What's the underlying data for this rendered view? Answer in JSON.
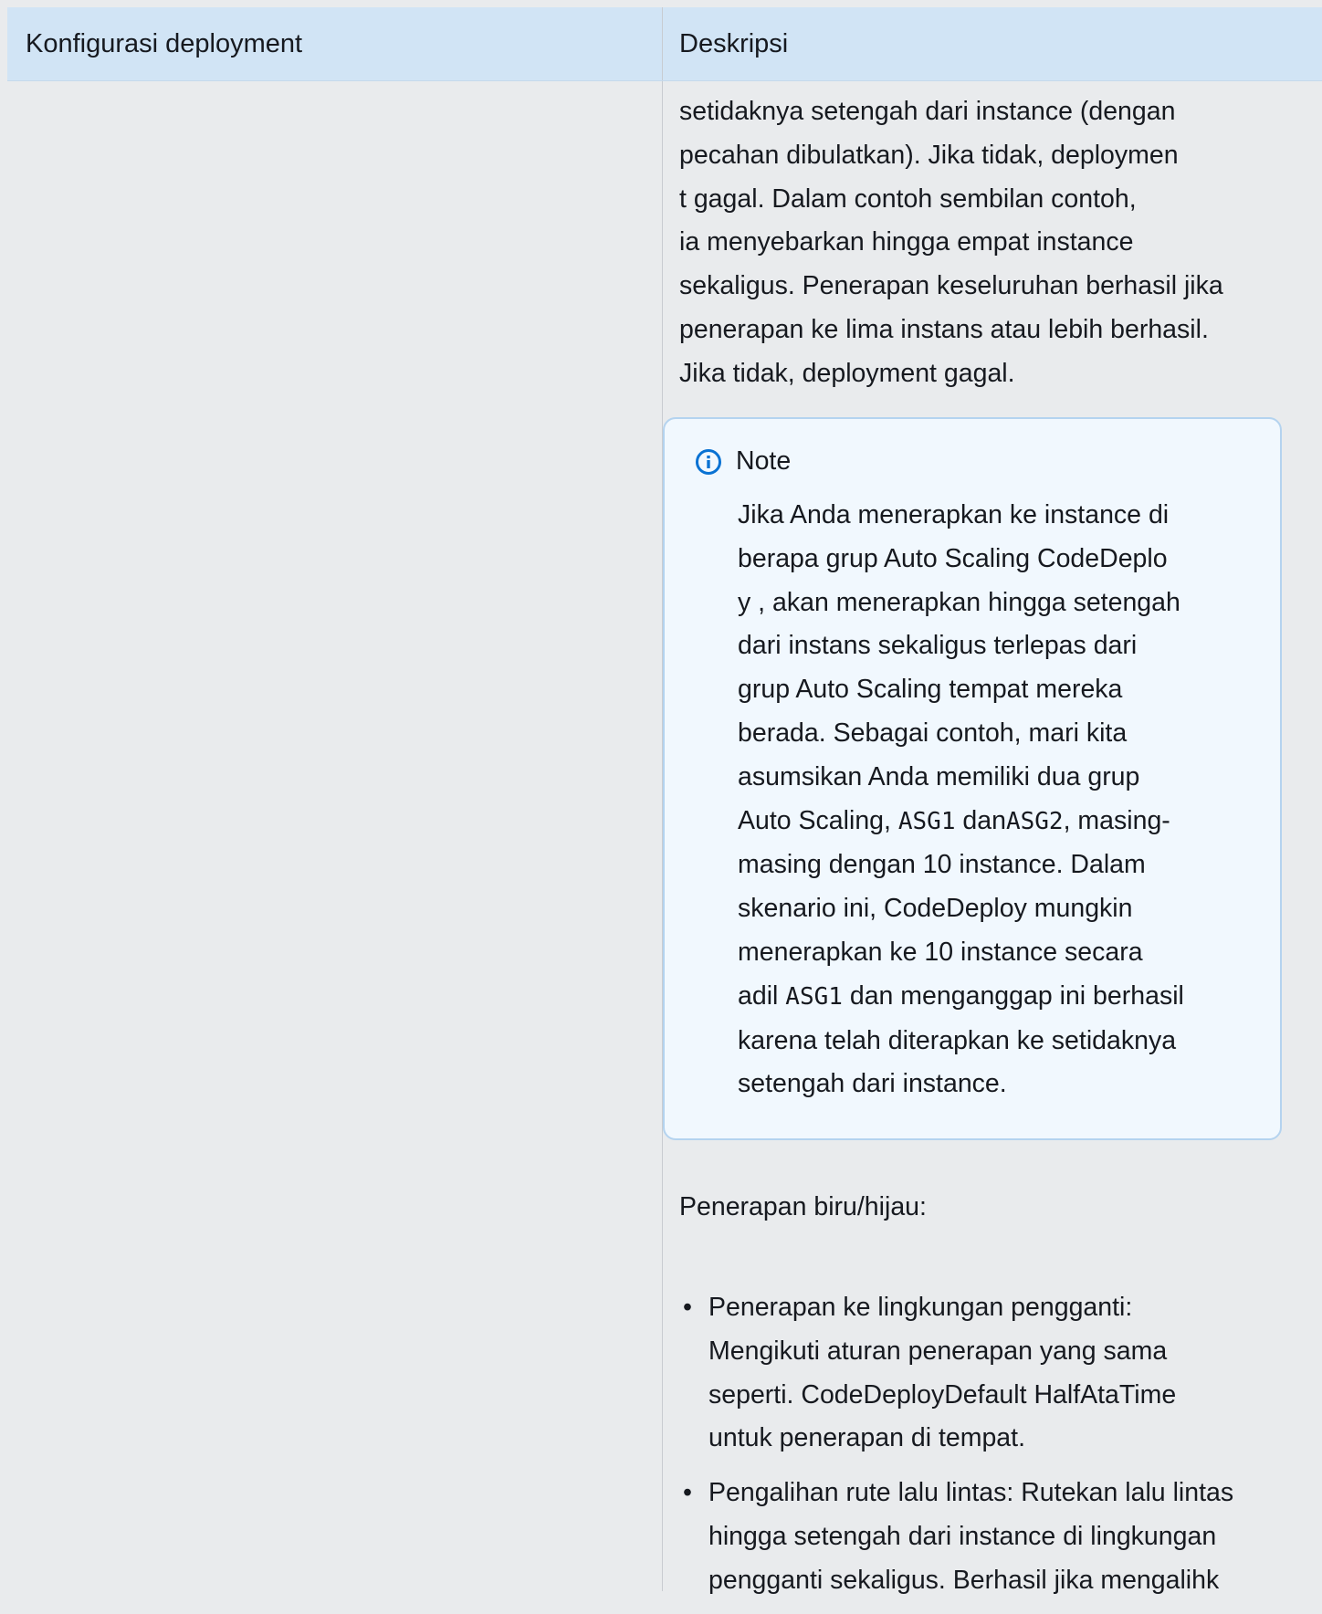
{
  "header": {
    "col1": "Konfigurasi deployment",
    "col2": "Deskripsi"
  },
  "description": {
    "intro": "setidaknya setengah dari instance (dengan\npecahan dibulatkan). Jika tidak, deploymen\nt gagal. Dalam contoh sembilan contoh,\nia menyebarkan hingga empat instance\nsekaligus. Penerapan keseluruhan berhasil jika\npenerapan ke lima instans atau lebih berhasil.\nJika tidak, deployment gagal.",
    "note": {
      "title": "Note",
      "line1": "Jika Anda menerapkan ke instance di\nberapa grup Auto Scaling CodeDeplo\ny , akan menerapkan hingga setengah\ndari instans sekaligus terlepas dari\ngrup Auto Scaling tempat mereka\nberada. Sebagai contoh, mari kita\nasumsikan Anda memiliki dua grup\nAuto Scaling, ",
      "code1": "ASG1",
      "mid1": " dan",
      "code2": "ASG2",
      "mid2": ", masing-\nmasing dengan 10 instance. Dalam\nskenario ini, CodeDeploy mungkin\nmenerapkan ke 10 instance secara\nadil ",
      "code3": "ASG1",
      "tail": " dan menganggap ini berhasil\nkarena telah diterapkan ke setidaknya\nsetengah dari instance."
    },
    "bluegreen_heading": "Penerapan biru/hijau:",
    "bullets": [
      "Penerapan ke lingkungan pengganti:\nMengikuti aturan penerapan yang sama\nseperti. CodeDeployDefault HalfAtaTime\nuntuk penerapan di tempat.",
      "Pengalihan rute lalu lintas: Rutekan lalu lintas\nhingga setengah dari instance di lingkungan\npengganti sekaligus. Berhasil jika mengalihk"
    ]
  }
}
